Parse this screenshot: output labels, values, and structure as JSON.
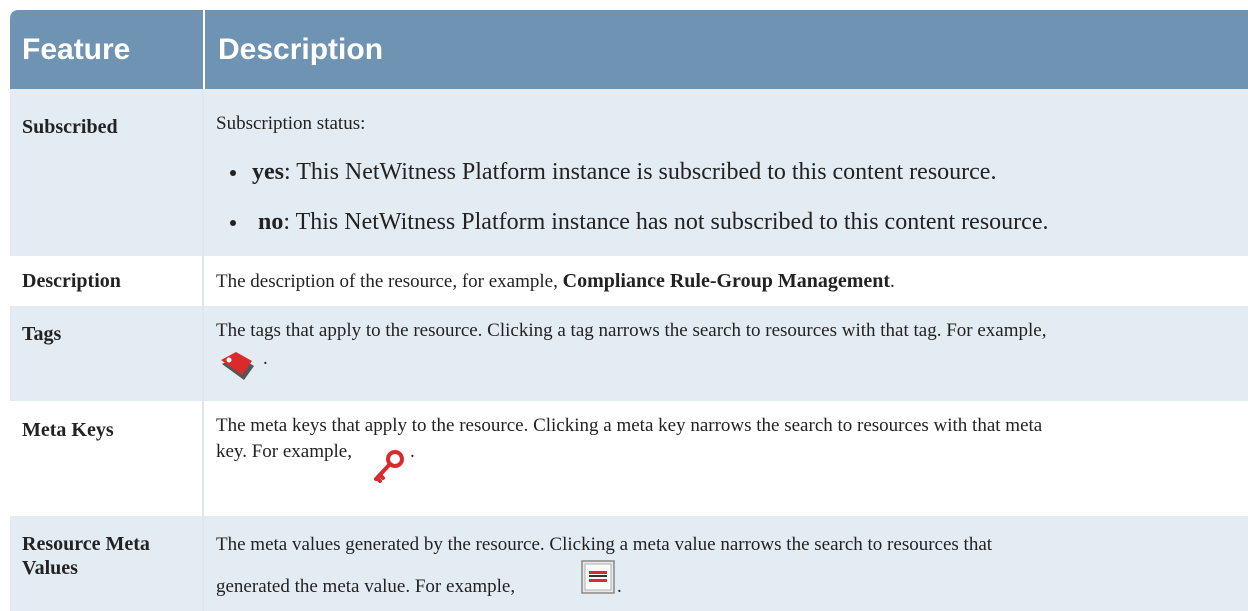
{
  "header": {
    "col1": "Feature",
    "col2": "Description"
  },
  "rows": {
    "subscribed": {
      "feature": "Subscribed",
      "intro": "Subscription status:",
      "yes_term": "yes",
      "yes_text": ": This NetWitness Platform instance is subscribed to this content resource.",
      "no_term": "no",
      "no_text": ": This NetWitness Platform instance has not subscribed to this content resource."
    },
    "description": {
      "feature": "Description",
      "text": "The description of the resource, for example, ",
      "bold": "Compliance Rule-Group Management",
      "tail": "."
    },
    "tags": {
      "feature": "Tags",
      "text": "The tags that apply to the resource. Clicking a tag narrows the search to resources with that tag. For example,",
      "tail": ".",
      "icon": "tag-icon"
    },
    "meta_keys": {
      "feature": "Meta Keys",
      "line1": "The meta keys that apply to the resource. Clicking a meta key narrows the search to resources with that meta",
      "line2": "key. For example, ",
      "tail": ".",
      "icon": "key-icon"
    },
    "meta_values": {
      "feature_line1": "Resource Meta",
      "feature_line2": "Values",
      "line1": "The meta values generated by the resource. Clicking a meta value narrows the search to resources that",
      "line2": "generated the meta value. For example, ",
      "tail": ".",
      "icon": "meta-value-icon"
    }
  },
  "colors": {
    "header_bg": "#6f93b2",
    "row_alt_bg": "#e4ecf3",
    "icon_red": "#d92b2b"
  }
}
